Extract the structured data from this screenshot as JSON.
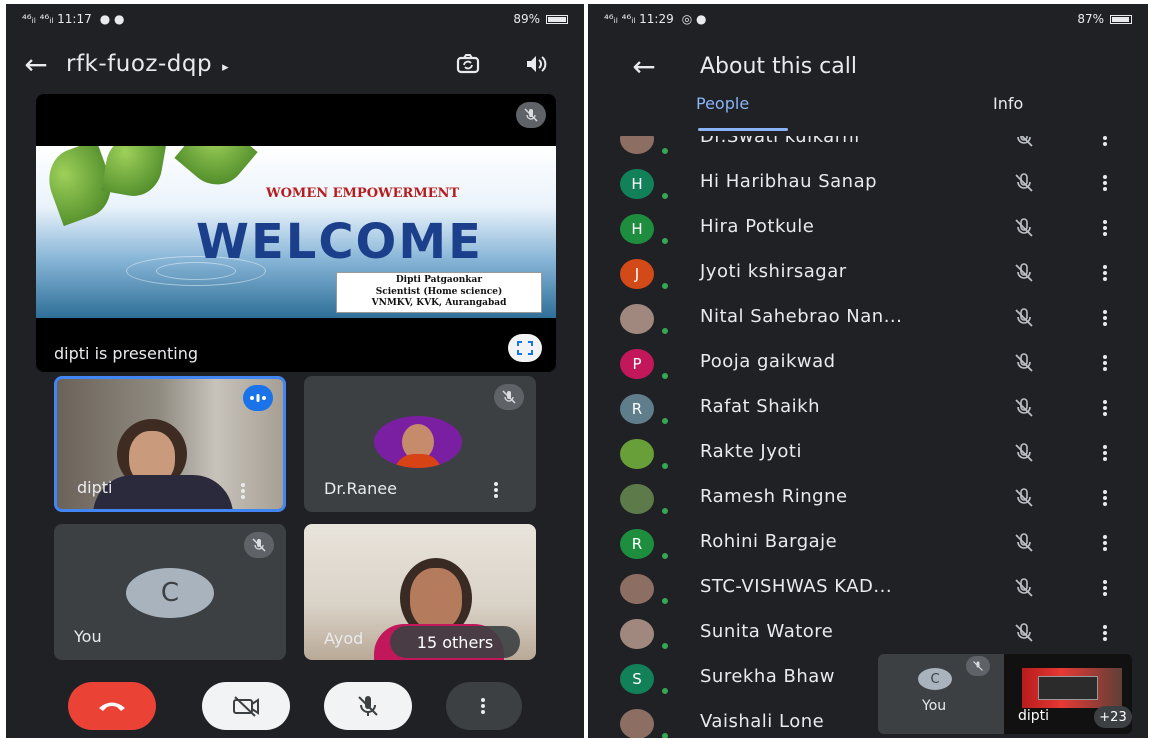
{
  "left": {
    "status": {
      "left": "⁴⁶ᵢₗ ⁴⁶ᵢₗ 11:17",
      "right": "89%"
    },
    "topbar": {
      "meeting_code": "rfk-fuoz-dqp",
      "code_arrow": "▸"
    },
    "presentation": {
      "slide_title": "WOMEN EMPOWERMENT",
      "slide_heading": "WELCOME",
      "credit": [
        "Dipti Patgaonkar",
        "Scientist (Home science)",
        "VNMKV, KVK, Aurangabad"
      ],
      "caption": "dipti is presenting"
    },
    "tiles": [
      {
        "name": "dipti"
      },
      {
        "name": "Dr.Ranee"
      },
      {
        "name": "You",
        "initial": "C"
      },
      {
        "name": "Ayod",
        "others": "15 others"
      }
    ]
  },
  "right": {
    "status": {
      "left": "⁴⁶ᵢₗ ⁴⁶ᵢₗ 11:29",
      "right": "87%"
    },
    "header": {
      "title": "About this call"
    },
    "tabs": {
      "people": "People",
      "info": "Info"
    },
    "people": [
      {
        "name": "Dr.Swati kulkarni",
        "initial": "",
        "color": "#8d6e63"
      },
      {
        "name": "Hi Haribhau Sanap",
        "initial": "H",
        "color": "#12815a"
      },
      {
        "name": "Hira Potkule",
        "initial": "H",
        "color": "#1e8e3e"
      },
      {
        "name": "Jyoti kshirsagar",
        "initial": "J",
        "color": "#d24a17"
      },
      {
        "name": "Nital Sahebrao Nan...",
        "initial": "",
        "color": "#a1887f"
      },
      {
        "name": "Pooja gaikwad",
        "initial": "P",
        "color": "#c2185b"
      },
      {
        "name": "Rafat Shaikh",
        "initial": "R",
        "color": "#607d8b"
      },
      {
        "name": "Rakte Jyoti",
        "initial": "",
        "color": "#689f38"
      },
      {
        "name": "Ramesh Ringne",
        "initial": "",
        "color": "#5d7b4a"
      },
      {
        "name": "Rohini Bargaje",
        "initial": "R",
        "color": "#1e8e3e"
      },
      {
        "name": "STC-VISHWAS KAD...",
        "initial": "",
        "color": "#8d6e63"
      },
      {
        "name": "Sunita Watore",
        "initial": "",
        "color": "#a1887f"
      },
      {
        "name": "Surekha Bhaw",
        "initial": "S",
        "color": "#12815a"
      },
      {
        "name": "Vaishali Lone",
        "initial": "",
        "color": "#8d6e63"
      }
    ],
    "pip": {
      "you_initial": "C",
      "you_label": "You",
      "dipti_label": "dipti",
      "count": "+23"
    }
  }
}
